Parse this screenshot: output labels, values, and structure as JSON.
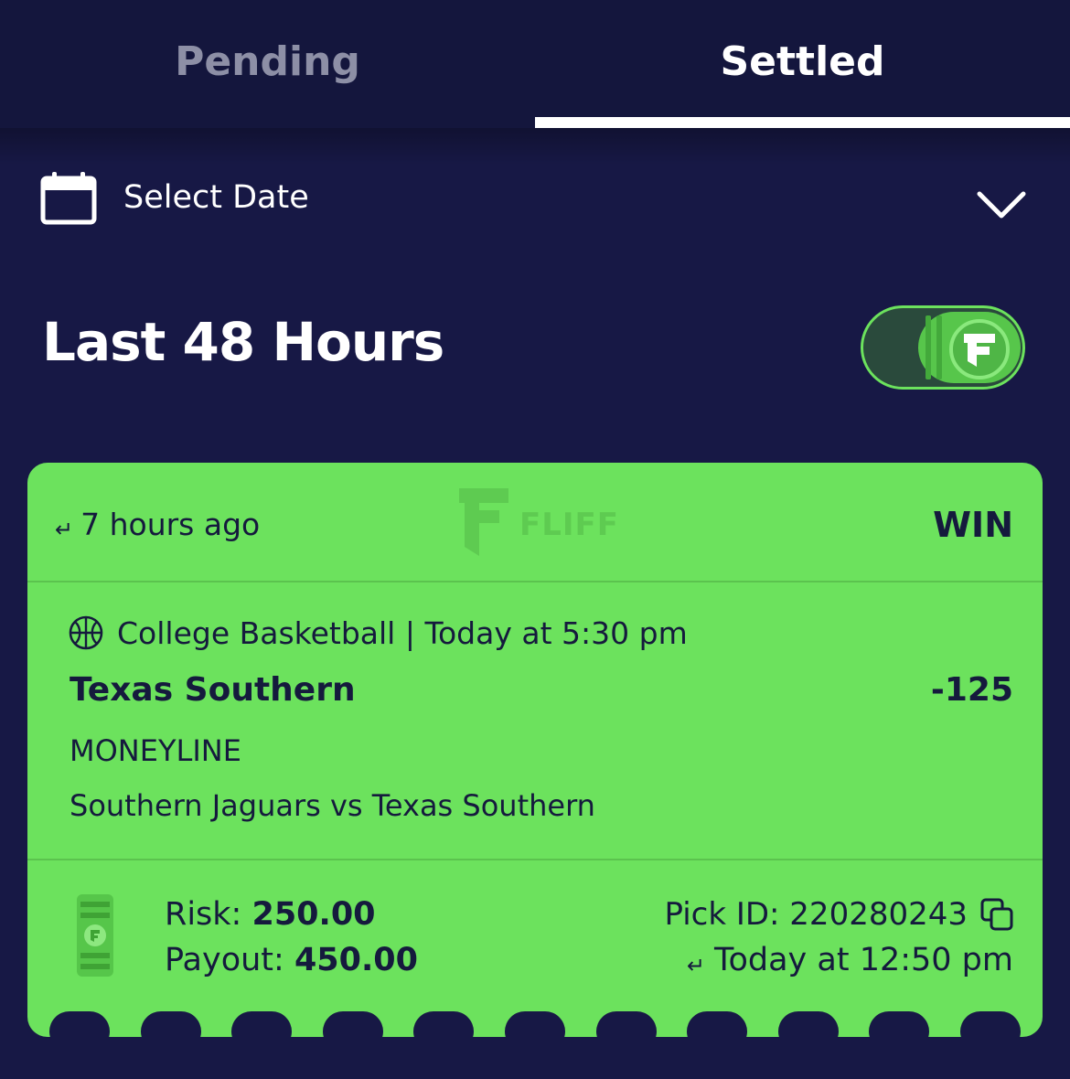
{
  "tabs": [
    {
      "label": "Pending",
      "active": false
    },
    {
      "label": "Settled",
      "active": true
    }
  ],
  "date_filter": {
    "label": "Select Date",
    "icon": "calendar-icon",
    "expand_icon": "chevron-down-icon"
  },
  "section": {
    "title": "Last 48 Hours",
    "toggle_icon": "fliff-coin-toggle"
  },
  "bet_card": {
    "time_ago": "7 hours ago",
    "brand_watermark": "FLIFF",
    "result": "WIN",
    "sport_icon": "basketball-icon",
    "event_info": "College Basketball | Today at 5:30 pm",
    "selection": "Texas Southern",
    "odds": "-125",
    "market": "MONEYLINE",
    "matchup": "Southern Jaguars vs Texas Southern",
    "risk_label": "Risk: ",
    "risk_value": "250.00",
    "payout_label": "Payout: ",
    "payout_value": "450.00",
    "pick_id": "Pick ID: 220280243",
    "placed_time": "Today at 12:50 pm"
  },
  "colors": {
    "background": "#171845",
    "tab_bar": "#14163d",
    "card_win": "#6ce25d",
    "card_text": "#151a3d",
    "inactive_tab": "#8d8fa6"
  }
}
